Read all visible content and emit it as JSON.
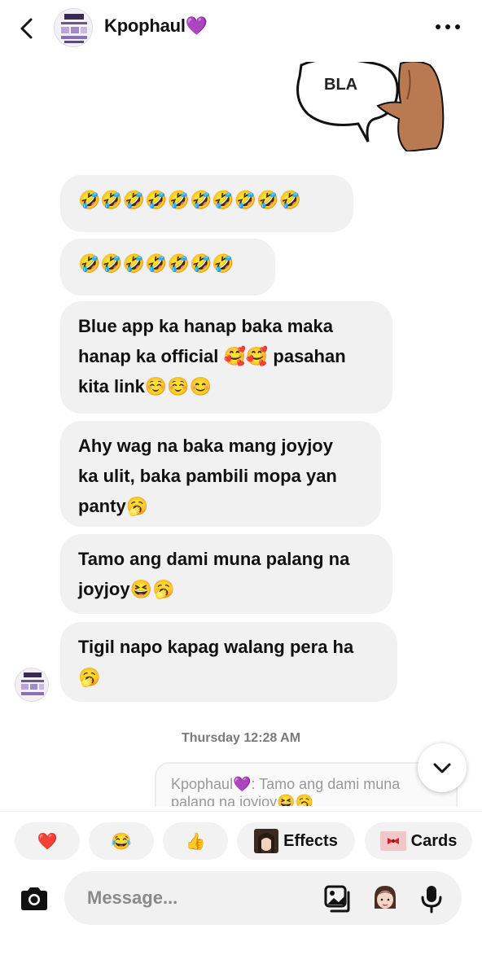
{
  "header": {
    "title": "Kpophaul💜",
    "back_icon": "chevron-left-icon",
    "more_icon": "more-horizontal-icon"
  },
  "sticker": {
    "text": "BLA"
  },
  "messages": [
    {
      "text": "🤣🤣🤣🤣🤣🤣🤣🤣🤣🤣"
    },
    {
      "text": "🤣🤣🤣🤣🤣🤣🤣"
    },
    {
      "lines": [
        "Blue app ka hanap baka maka",
        "hanap ka official 🥰🥰 pasahan",
        "kita link☺️☺️😊"
      ]
    },
    {
      "lines": [
        "Ahy wag na baka mang joyjoy",
        "ka ulit, baka pambili mopa yan",
        "panty🥱"
      ]
    },
    {
      "lines": [
        "Tamo ang dami muna palang na",
        "joyjoy😆🥱"
      ]
    },
    {
      "lines": [
        "Tigil napo kapag walang pera ha",
        "🥱"
      ]
    }
  ],
  "timestamp": "Thursday 12:28 AM",
  "reply": {
    "line1": "Kpophaul💜: Tamo ang dami muna",
    "line2": "palang na joyjoy😆🥱"
  },
  "reactions": {
    "heart": "❤️",
    "laugh": "😂",
    "thumbs": "👍",
    "effects_label": "Effects",
    "cards_label": "Cards"
  },
  "composer": {
    "placeholder": "Message..."
  },
  "colors": {
    "bubble": "#f1f1f1",
    "accent": "#8e44ad",
    "text": "#111111",
    "muted": "#8a8a8a"
  }
}
